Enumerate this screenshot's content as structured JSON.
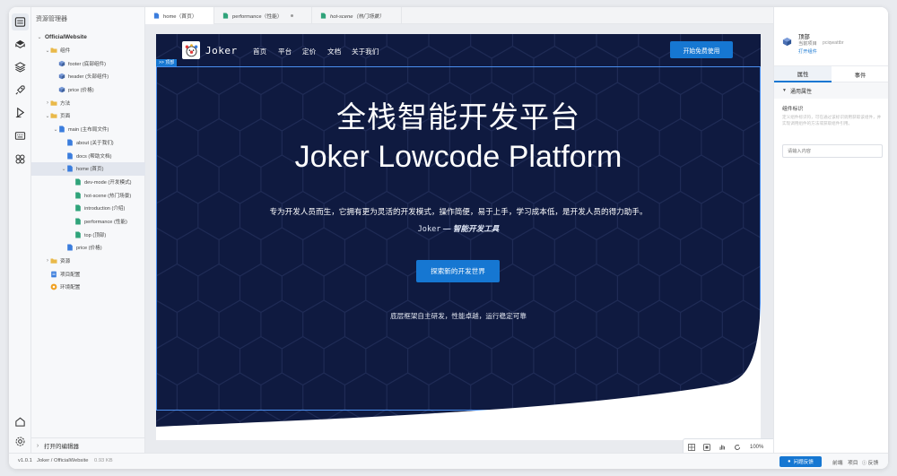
{
  "explorer": {
    "title": "资源管理器",
    "open_editors": "打开的编辑器",
    "tree": [
      {
        "label": "OfficialWebsite",
        "depth": 0,
        "kind": "root",
        "expanded": true
      },
      {
        "label": "组件",
        "depth": 1,
        "kind": "folder",
        "expanded": true
      },
      {
        "label": "footer (底部组件)",
        "depth": 2,
        "kind": "component"
      },
      {
        "label": "header (头部组件)",
        "depth": 2,
        "kind": "component"
      },
      {
        "label": "price (价格)",
        "depth": 2,
        "kind": "component"
      },
      {
        "label": "方法",
        "depth": 1,
        "kind": "folder",
        "expanded": false
      },
      {
        "label": "页面",
        "depth": 1,
        "kind": "folder",
        "expanded": true
      },
      {
        "label": "main (主布局文件)",
        "depth": 2,
        "kind": "page",
        "expanded": true
      },
      {
        "label": "about (关于我们)",
        "depth": 3,
        "kind": "page"
      },
      {
        "label": "docs (帮助文档)",
        "depth": 3,
        "kind": "page"
      },
      {
        "label": "home (首页)",
        "depth": 3,
        "kind": "page",
        "expanded": true,
        "selected": true
      },
      {
        "label": "dev-mode (开发模式)",
        "depth": 4,
        "kind": "section"
      },
      {
        "label": "hot-scene (热门场景)",
        "depth": 4,
        "kind": "section"
      },
      {
        "label": "introduction (介绍)",
        "depth": 4,
        "kind": "section"
      },
      {
        "label": "performance (性能)",
        "depth": 4,
        "kind": "section"
      },
      {
        "label": "top (顶部)",
        "depth": 4,
        "kind": "section"
      },
      {
        "label": "price (价格)",
        "depth": 3,
        "kind": "page"
      },
      {
        "label": "资源",
        "depth": 1,
        "kind": "folder",
        "expanded": false
      },
      {
        "label": "项目配置",
        "depth": 1,
        "kind": "config"
      },
      {
        "label": "环境配置",
        "depth": 1,
        "kind": "env"
      }
    ]
  },
  "tabs": [
    {
      "label": "home（首页）",
      "italic": false,
      "dot": false,
      "active": true
    },
    {
      "label": "performance（性能）",
      "italic": false,
      "dot": true,
      "active": false
    },
    {
      "label": "hot-scene（热门场景）",
      "italic": true,
      "dot": false,
      "active": false
    }
  ],
  "hero": {
    "brand": "Joker",
    "nav_links": [
      "首页",
      "平台",
      "定价",
      "文档",
      "关于我们"
    ],
    "nav_cta": "开始免费使用",
    "selection_label": ">> 顶部",
    "title_cn": "全栈智能开发平台",
    "title_en": "Joker Lowcode Platform",
    "description": "专为开发人员而生，它拥有更为灵活的开发模式，操作简便，易于上手，学习成本低，是开发人员的得力助手。",
    "tagline_brand": "Joker",
    "tagline_rest": "— 智能开发工具",
    "explore_button": "探索新的开发世界",
    "footnote": "底层框架自主研发，性能卓越，运行稳定可靠"
  },
  "zoom": {
    "value": "100%"
  },
  "right_panel": {
    "title": "顶部",
    "subtitle": "当前项目",
    "project_id": "pciqwattbr",
    "open_link": "打开组件",
    "tabs": [
      "属性",
      "事件"
    ],
    "group_title": "通用属性",
    "field_label": "组件标识",
    "field_desc": "定义组件标识符，可在通过该标识调用获取该组件，并实现调用组件的方法或获取组件引用。",
    "input_placeholder": "请输入内容"
  },
  "status": {
    "version": "v1.0.1",
    "path": "Joker / OfficialWebsite",
    "size": "0.93 KB",
    "feedback_button": "问题反馈",
    "links": [
      "前端",
      "项目",
      "反馈"
    ]
  },
  "colors": {
    "accent": "#1677d2",
    "hero_bg": "#0f1a40",
    "component_icon": "#7b9cd9",
    "page_icon": "#3b7ddd",
    "section_icon": "#2fa37a",
    "folder_icon": "#e9b949"
  }
}
